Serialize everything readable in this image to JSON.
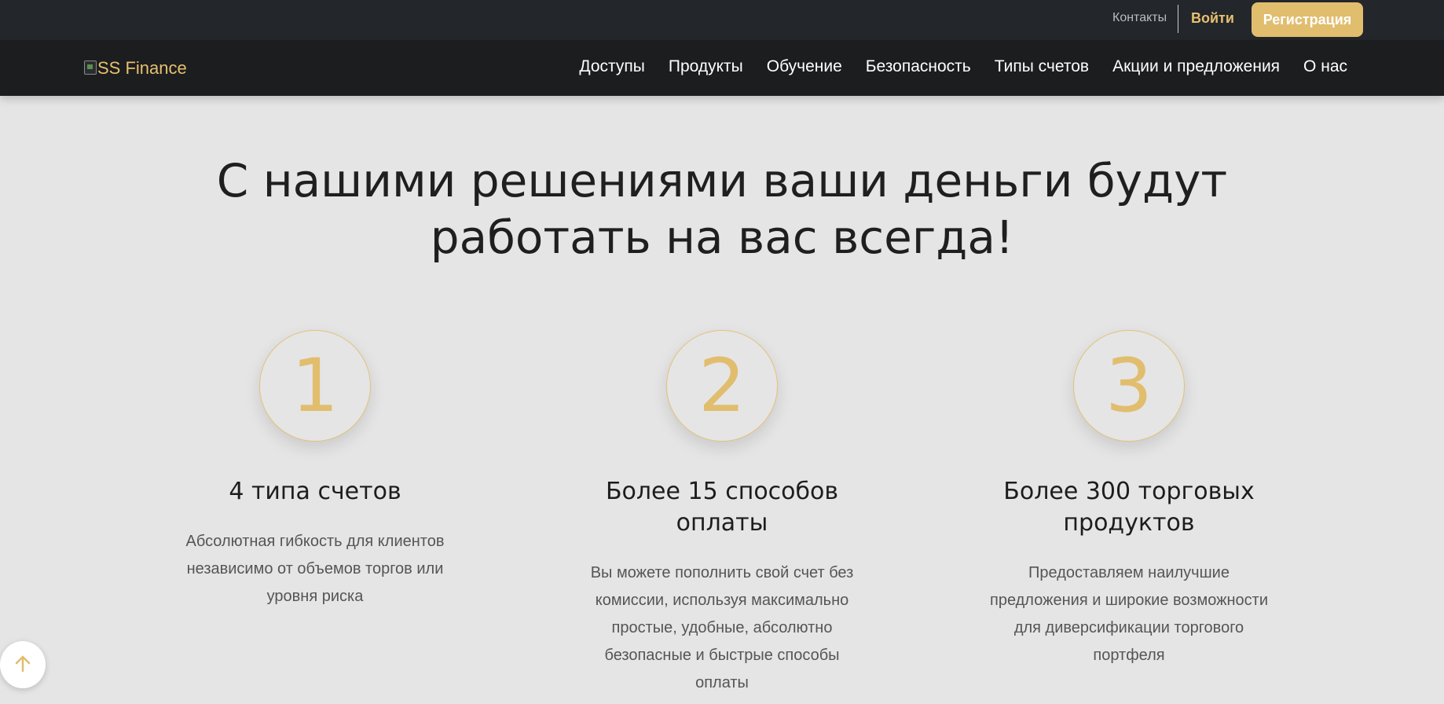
{
  "topbar": {
    "contacts_label": "Контакты",
    "login_label": "Войти",
    "register_label": "Регистрация"
  },
  "navbar": {
    "logo_text": "SS Finance",
    "links": [
      "Доступы",
      "Продукты",
      "Обучение",
      "Безопасность",
      "Типы счетов",
      "Акции и предложения",
      "О нас"
    ]
  },
  "hero": {
    "headline_line1": "С нашими решениями ваши деньги будут",
    "headline_line2": "работать на вас всегда!"
  },
  "features": [
    {
      "number": "1",
      "title_line1": "4 типа счетов",
      "title_line2": "",
      "description_lines": [
        "Абсолютная гибкость для клиентов",
        "независимо от объемов торгов или",
        "уровня риска"
      ]
    },
    {
      "number": "2",
      "title_line1": "Более 15 способов",
      "title_line2": "оплаты",
      "description_lines": [
        "Вы можете пополнить свой счет без",
        "комиссии, используя максимально",
        "простые, удобные, абсолютно",
        "безопасные и быстрые способы",
        "оплаты"
      ]
    },
    {
      "number": "3",
      "title_line1": "Более 300 торговых",
      "title_line2": "продуктов",
      "description_lines": [
        "Предоставляем наилучшие",
        "предложения и широкие возможности",
        "для диверсификации торгового",
        "портфеля"
      ]
    }
  ],
  "icons": {
    "scroll_top": "arrow-up-icon",
    "logo_image": "broken-image-icon"
  },
  "colors": {
    "accent": "#e1bd6e",
    "topbar_bg": "#23262b",
    "navbar_bg": "#1c1d1f",
    "page_bg": "#e5e5e5"
  }
}
